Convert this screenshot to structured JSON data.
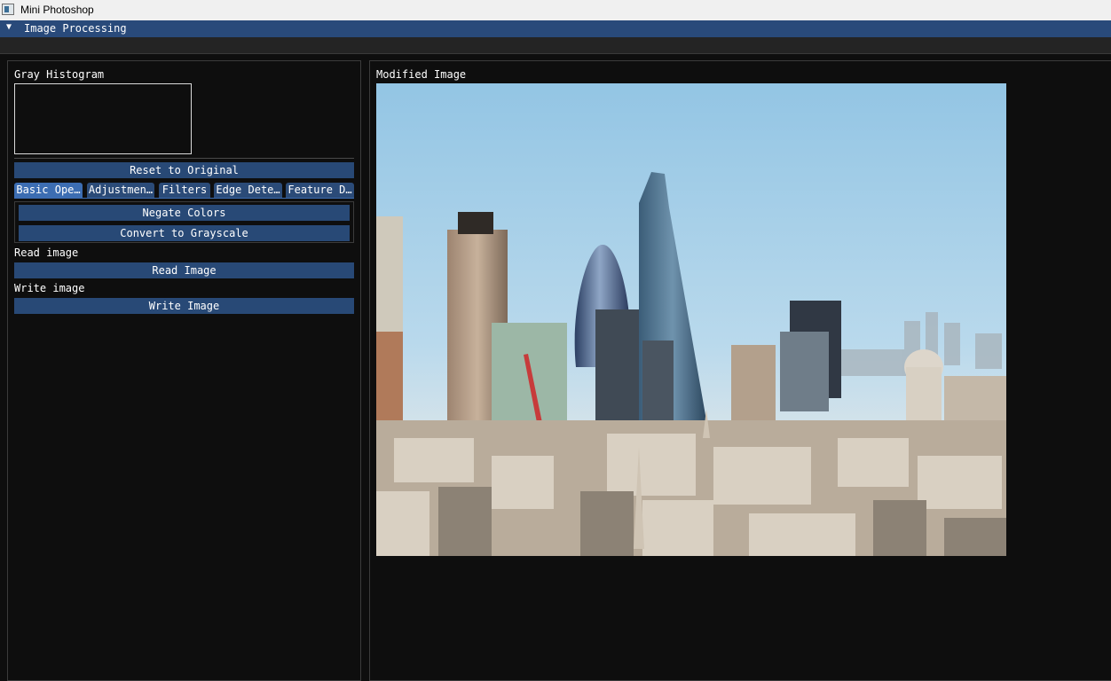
{
  "window": {
    "title": "Mini Photoshop",
    "icon": "app-window-icon"
  },
  "header": {
    "arrow": "▼",
    "label": "Image Processing"
  },
  "left": {
    "histogram_label": "Gray Histogram",
    "reset_button": "Reset to Original",
    "tabs": [
      {
        "label": "Basic Ope…",
        "active": true
      },
      {
        "label": "Adjustmen…",
        "active": false
      },
      {
        "label": "Filters",
        "active": false
      },
      {
        "label": "Edge Dete…",
        "active": false
      },
      {
        "label": "Feature D…",
        "active": false
      }
    ],
    "negate_button": "Negate Colors",
    "grayscale_button": "Convert to Grayscale",
    "read_label": "Read image",
    "read_button": "Read Image",
    "write_label": "Write image",
    "write_button": "Write Image"
  },
  "right": {
    "modified_label": "Modified Image"
  },
  "colors": {
    "accent": "#294a7a",
    "button": "#284976",
    "tab_active": "#3c6db2",
    "background": "#0e0e0e"
  }
}
